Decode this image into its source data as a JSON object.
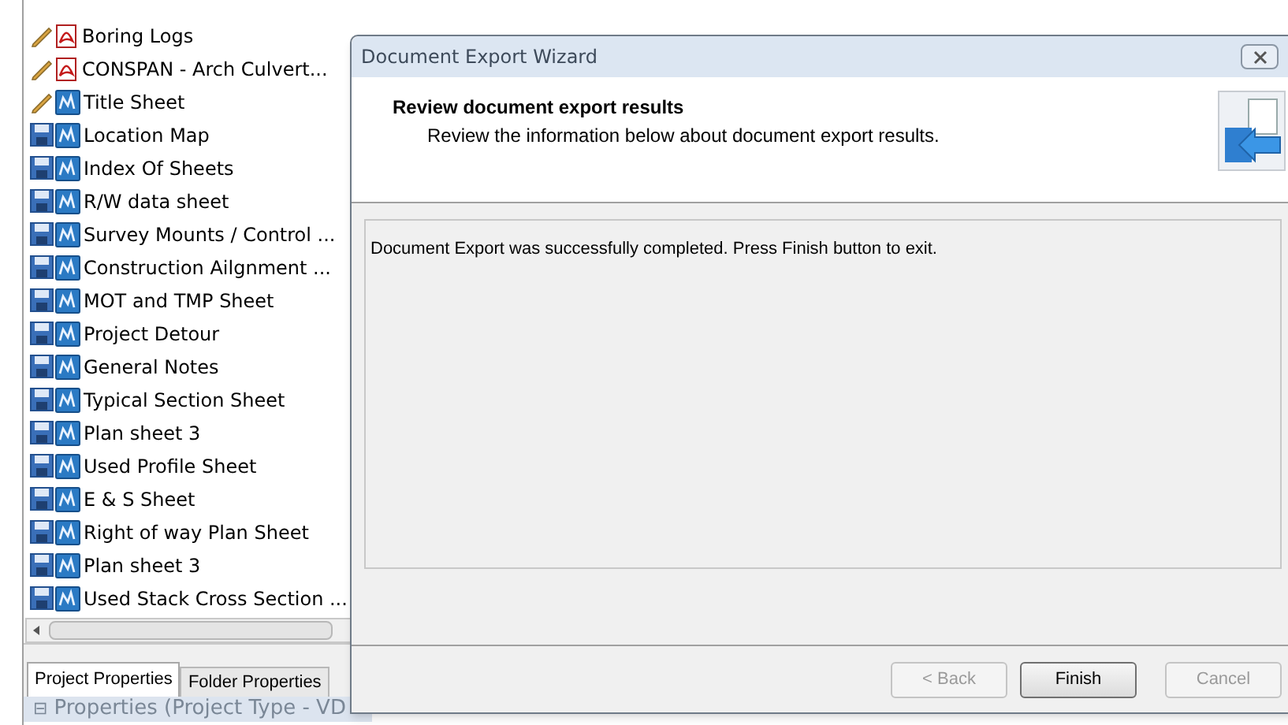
{
  "document_list": [
    {
      "name": "Boring Logs",
      "kind": "edit-pdf"
    },
    {
      "name": "CONSPAN - Arch Culvert...",
      "kind": "edit-pdf"
    },
    {
      "name": "Title Sheet",
      "kind": "edit-doc"
    },
    {
      "name": "Location Map",
      "kind": "saved-doc"
    },
    {
      "name": "Index Of Sheets",
      "kind": "saved-doc"
    },
    {
      "name": "R/W data sheet",
      "kind": "saved-doc"
    },
    {
      "name": "Survey Mounts / Control ...",
      "kind": "saved-doc"
    },
    {
      "name": "Construction Ailgnment ...",
      "kind": "saved-doc"
    },
    {
      "name": "MOT and TMP Sheet",
      "kind": "saved-doc"
    },
    {
      "name": "Project Detour",
      "kind": "saved-doc"
    },
    {
      "name": "General Notes",
      "kind": "saved-doc"
    },
    {
      "name": "Typical Section Sheet",
      "kind": "saved-doc"
    },
    {
      "name": "Plan sheet 3",
      "kind": "saved-doc"
    },
    {
      "name": "Used Profile Sheet",
      "kind": "saved-doc"
    },
    {
      "name": "E & S Sheet",
      "kind": "saved-doc"
    },
    {
      "name": "Right of way Plan Sheet",
      "kind": "saved-doc"
    },
    {
      "name": "Plan sheet 3",
      "kind": "saved-doc"
    },
    {
      "name": "Used Stack Cross Section ...",
      "kind": "saved-doc"
    }
  ],
  "property_tabs": [
    {
      "label": "Project Properties",
      "selected": true
    },
    {
      "label": "Folder Properties",
      "selected": false
    }
  ],
  "properties_header": {
    "toggle": "⊟",
    "label": "Properties (Project Type - VD"
  },
  "dialog": {
    "title": "Document Export Wizard",
    "heading": "Review document export results",
    "subheading": "Review the information below about document export results.",
    "message": "Document Export was successfully completed. Press Finish button to exit.",
    "buttons": [
      {
        "label": "< Back",
        "disabled": true
      },
      {
        "label": "Finish",
        "disabled": false
      },
      {
        "label": "Cancel",
        "disabled": true
      }
    ]
  }
}
